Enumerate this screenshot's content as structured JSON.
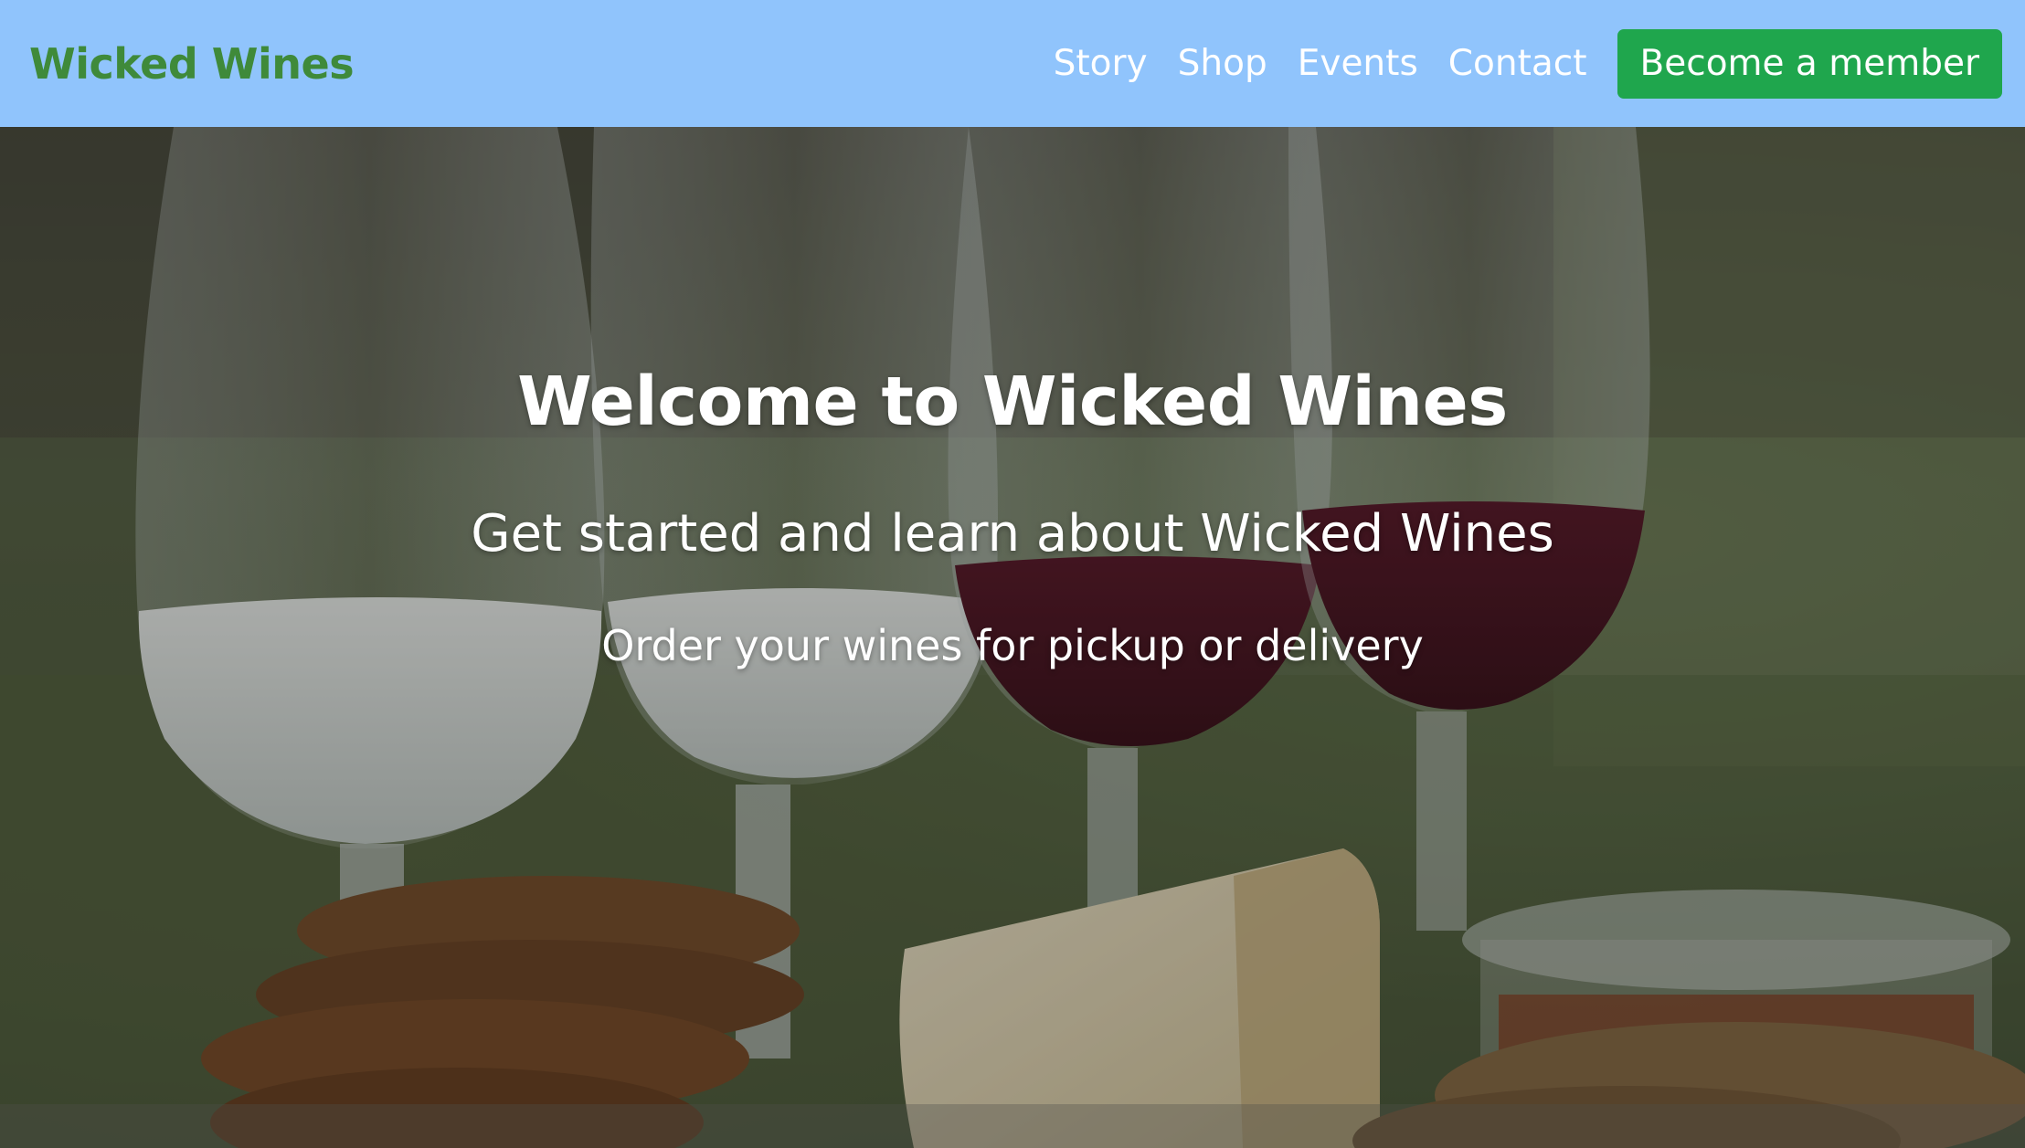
{
  "colors": {
    "navbar_bg": "#90c4fc",
    "brand": "#3f8a3a",
    "nav_text": "#ffffff",
    "cta_bg": "#1fa64d",
    "hero_text": "#ffffff"
  },
  "navbar": {
    "brand": "Wicked Wines",
    "links": [
      {
        "label": "Story"
      },
      {
        "label": "Shop"
      },
      {
        "label": "Events"
      },
      {
        "label": "Contact"
      }
    ],
    "cta_label": "Become a member"
  },
  "hero": {
    "title": "Welcome to Wicked Wines",
    "subtitle": "Get started and learn about Wicked Wines",
    "tagline": "Order your wines for pickup or delivery"
  }
}
